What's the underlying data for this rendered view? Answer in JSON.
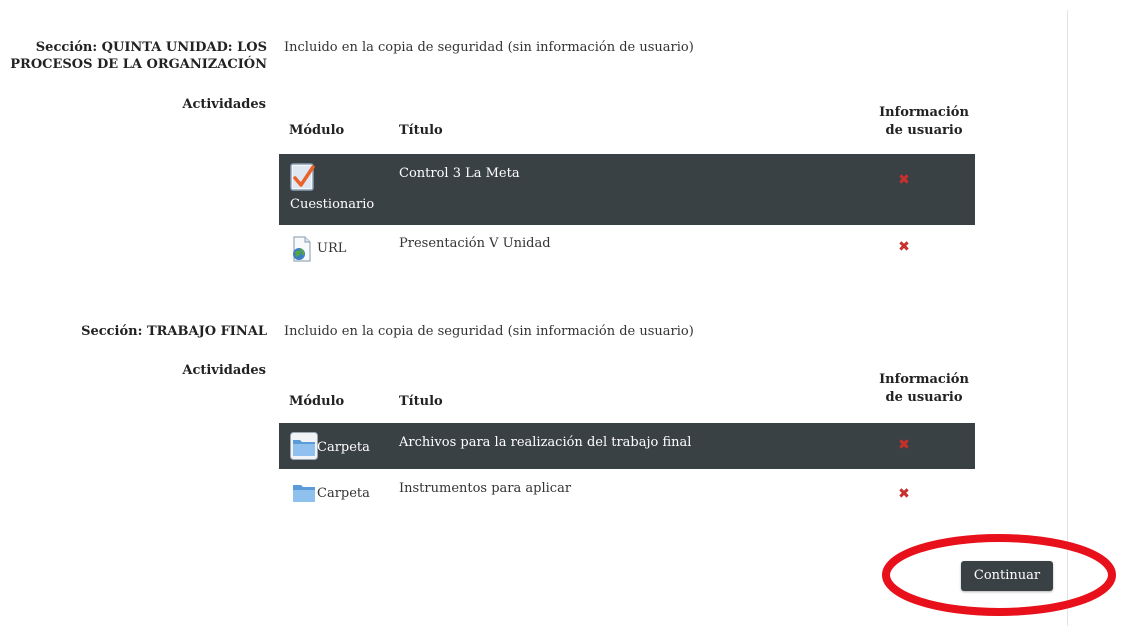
{
  "sections": [
    {
      "label_line1": "Sección: QUINTA UNIDAD: LOS",
      "label_line2": "PROCESOS DE LA ORGANIZACIÓN",
      "info": "Incluido en la copia de seguridad (sin información de usuario)",
      "activities_label": "Actividades",
      "headers": {
        "module": "Módulo",
        "title": "Título",
        "user_info_line1": "Información",
        "user_info_line2": "de usuario"
      },
      "rows": [
        {
          "module": "Cuestionario",
          "title": "Control 3 La Meta",
          "icon": "quiz-icon"
        },
        {
          "module": "URL",
          "title": "Presentación V Unidad",
          "icon": "url-icon"
        }
      ]
    },
    {
      "label": "Sección: TRABAJO FINAL",
      "info": "Incluido en la copia de seguridad (sin información de usuario)",
      "activities_label": "Actividades",
      "headers": {
        "module": "Módulo",
        "title": "Título",
        "user_info_line1": "Información",
        "user_info_line2": "de usuario"
      },
      "rows": [
        {
          "module": "Carpeta",
          "title": "Archivos para la realización del trabajo final",
          "icon": "folder-icon"
        },
        {
          "module": "Carpeta",
          "title": "Instrumentos para aplicar",
          "icon": "folder-icon"
        }
      ]
    }
  ],
  "continue_button": "Continuar",
  "colors": {
    "dark_row": "#3a4145",
    "excluded_mark": "#c9302c",
    "annotation": "#e8101a"
  }
}
